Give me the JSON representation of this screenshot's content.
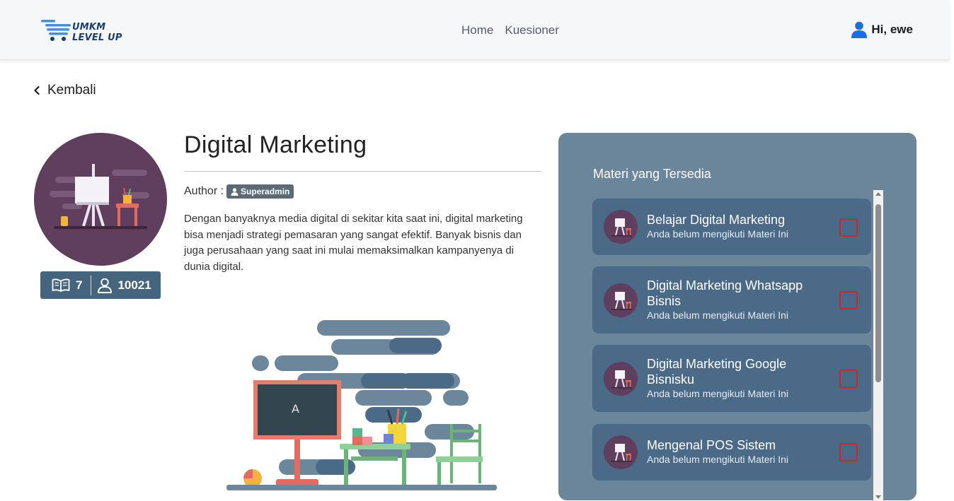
{
  "nav": {
    "logo_line1": "UMKM",
    "logo_line2": "LEVEL UP",
    "links": [
      "Home",
      "Kuesioner"
    ],
    "user_greeting": "Hi, ewe",
    "brand_color": "#1a3d78",
    "user_icon_color": "#1a6fe0"
  },
  "back": {
    "label": "Kembali"
  },
  "course": {
    "title": "Digital Marketing",
    "author_label": "Author :",
    "author_name": "Superadmin",
    "description": "Dengan banyaknya media digital di sekitar kita saat ini, digital marketing bisa menjadi strategi pemasaran yang sangat efektif. Banyak bisnis dan juga perusahaan yang saat ini mulai memaksimalkan kampanyenya di dunia digital.",
    "materials_count": "7",
    "participants_count": "10021",
    "stats_icons": [
      "book-icon",
      "user-icon"
    ]
  },
  "materials": {
    "heading": "Materi yang Tersedia",
    "items": [
      {
        "title": "Belajar Digital Marketing",
        "status": "Anda belum mengikuti Materi Ini",
        "checked": false
      },
      {
        "title": "Digital Marketing Whatsapp Bisnis",
        "status": "Anda belum mengikuti Materi Ini",
        "checked": false
      },
      {
        "title": "Digital Marketing Google Bisnisku",
        "status": "Anda belum mengikuti Materi Ini",
        "checked": false
      },
      {
        "title": "Mengenal POS Sistem",
        "status": "Anda belum mengikuti Materi Ini",
        "checked": false
      }
    ],
    "checkbox_color": "#d0282a",
    "panel_color": "#6b869b",
    "card_color": "#4b6a88"
  }
}
